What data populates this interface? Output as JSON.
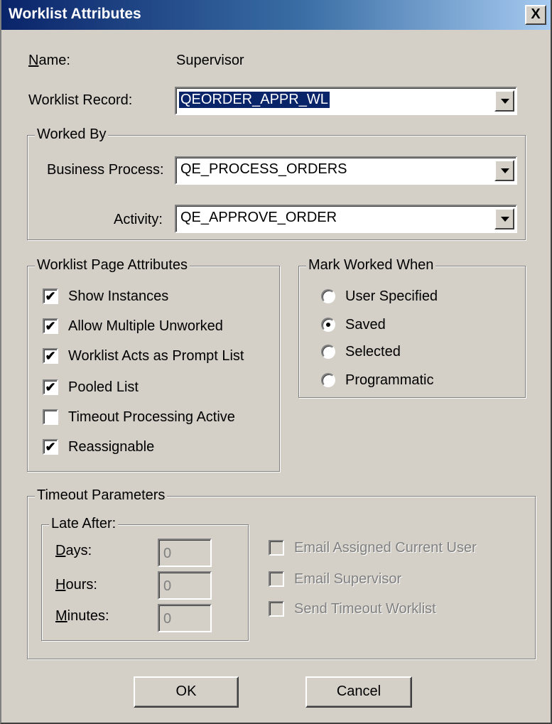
{
  "window": {
    "title": "Worklist Attributes",
    "close_label": "X"
  },
  "name_row": {
    "label_first": "N",
    "label_rest": "ame:",
    "value": "Supervisor"
  },
  "worklist_record": {
    "label": "Worklist Record:",
    "value": "QEORDER_APPR_WL"
  },
  "worked_by": {
    "title": "Worked By",
    "business_process_label": "Business Process:",
    "business_process_value": "QE_PROCESS_ORDERS",
    "activity_label": "Activity:",
    "activity_value": "QE_APPROVE_ORDER"
  },
  "page_attributes": {
    "title": "Worklist Page Attributes",
    "items": [
      {
        "label": "Show Instances",
        "checked": true,
        "mark": "✔"
      },
      {
        "label": "Allow Multiple Unworked",
        "checked": true,
        "mark": "✔"
      },
      {
        "label": "Worklist Acts as Prompt List",
        "checked": true,
        "mark": "✔"
      },
      {
        "label": "Pooled List",
        "checked": true,
        "mark": "✔"
      },
      {
        "label": "Timeout Processing Active",
        "checked": false,
        "mark": ""
      },
      {
        "label": "Reassignable",
        "checked": true,
        "mark": "✔"
      }
    ]
  },
  "mark_worked": {
    "title": "Mark Worked When",
    "options": [
      "User Specified",
      "Saved",
      "Selected",
      "Programmatic"
    ],
    "selected": "Saved"
  },
  "timeout": {
    "title": "Timeout Parameters",
    "late_after_title": "Late After:",
    "days_first": "D",
    "days_rest": "ays:",
    "days_value": "0",
    "hours_first": "H",
    "hours_rest": "ours:",
    "hours_value": "0",
    "minutes_first": "M",
    "minutes_rest": "inutes:",
    "minutes_value": "0",
    "email_assigned": "Email Assigned Current User",
    "email_supervisor": "Email Supervisor",
    "send_timeout": "Send Timeout Worklist"
  },
  "buttons": {
    "ok": "OK",
    "cancel": "Cancel"
  }
}
